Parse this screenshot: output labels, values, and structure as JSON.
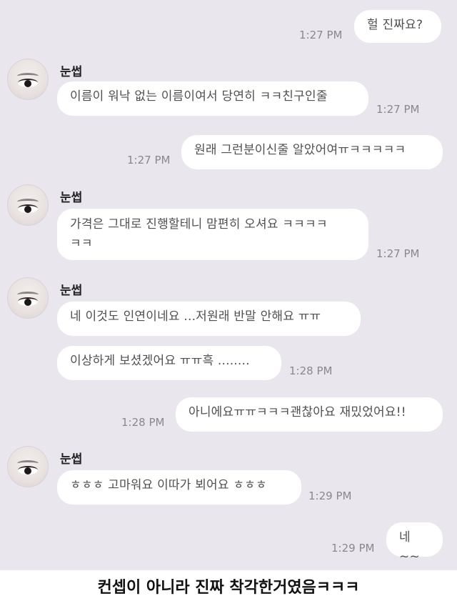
{
  "chat": {
    "sender_name": "눈썹",
    "messages": [
      {
        "side": "right",
        "text": "헐 진짜요?",
        "time": "1:27 PM"
      },
      {
        "side": "left",
        "text": "이름이 워낙 없는 이름이여서 당연히 ㅋㅋ친구인줄",
        "time": "1:27 PM"
      },
      {
        "side": "right",
        "text": "원래 그런분이신줄 알았어여ㅠㅋㅋㅋㅋㅋ",
        "time": "1:27 PM"
      },
      {
        "side": "left",
        "text_line1": "가격은 그대로 진행할테니 맘편히 오셔요 ㅋㅋㅋㅋ",
        "text_line2": "ㅋㅋ",
        "time": "1:27 PM"
      },
      {
        "side": "left",
        "text": "네 이것도 인연이네요 ...저원래 반말 안해요 ㅠㅠ"
      },
      {
        "side": "left",
        "text": "이상하게 보셨겠어요 ㅠㅠ흑 ........",
        "time": "1:28 PM"
      },
      {
        "side": "right",
        "text": "아니에요ㅠㅠㅋㅋㅋ괜찮아요 재밌었어요!!",
        "time": "1:28 PM"
      },
      {
        "side": "left",
        "text": "ㅎㅎㅎ 고마워요 이따가 뵈어요 ㅎㅎㅎ",
        "time": "1:29 PM"
      },
      {
        "side": "right",
        "text": "네~~",
        "time": "1:29 PM"
      }
    ]
  },
  "caption": "컨셉이 아니라 진짜 착각한거였음ㅋㅋㅋ",
  "icons": {
    "avatar": "eye-avatar-icon"
  },
  "colors": {
    "background": "#e9e6ee",
    "bubble": "#ffffff",
    "text": "#505050",
    "time": "#8a8790"
  }
}
